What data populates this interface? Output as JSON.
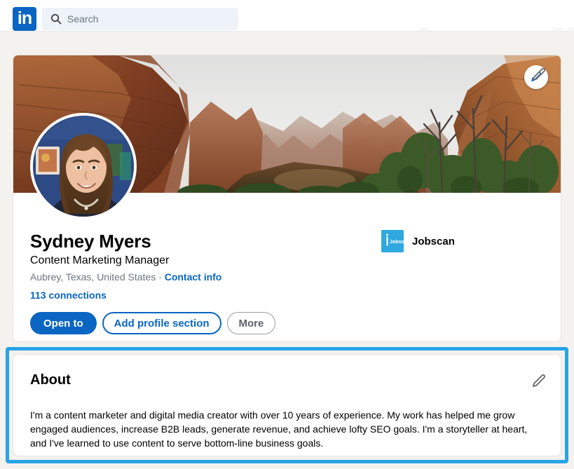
{
  "nav": {
    "logo_icon": "linkedin-logo",
    "search": {
      "icon": "search-icon",
      "placeholder": "Search",
      "value": ""
    }
  },
  "profile": {
    "banner": {
      "alt": "zion-canyon-banner-photo",
      "edit_icon": "pencil-icon"
    },
    "avatar": {
      "alt": "profile-photo-sydney-myers"
    },
    "edit_icon": "pencil-icon",
    "name": "Sydney Myers",
    "headline": "Content Marketing Manager",
    "location": "Aubrey, Texas, United States",
    "location_separator": " · ",
    "contact_info_label": "Contact info",
    "connections": "113 connections",
    "buttons": [
      {
        "label": "Open to",
        "style": "primary"
      },
      {
        "label": "Add profile section",
        "style": "outline-blue"
      },
      {
        "label": "More",
        "style": "outline-gray"
      }
    ],
    "company": {
      "logo_alt": "jobscan-logo",
      "logo_wordmark": "Jobscan",
      "name": "Jobscan"
    }
  },
  "about": {
    "title": "About",
    "edit_icon": "pencil-icon",
    "text": "I'm a content marketer and digital media creator with over 10 years of experience. My work has helped me grow engaged audiences, increase B2B leads, generate revenue, and achieve lofty SEO goals. I'm a storyteller at heart, and I've learned to use content to serve bottom-line business goals."
  },
  "colors": {
    "linkedin_blue": "#0a66c2",
    "page_background": "#f4f2ee",
    "highlight_border": "#29a3e8",
    "jobscan_blue": "#2fa8e0",
    "muted_text": "#6b7681"
  }
}
